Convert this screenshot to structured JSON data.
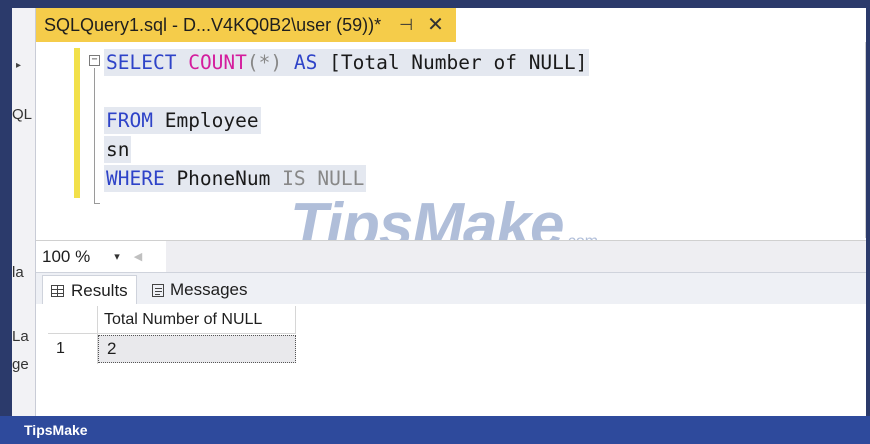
{
  "tab": {
    "title": "SQLQuery1.sql - D...V4KQ0B2\\user (59))*",
    "pin_glyph": "⊣",
    "close_glyph": "✕"
  },
  "editor": {
    "lines": [
      [
        {
          "text": "SELECT",
          "style": "kw"
        },
        {
          "text": " ",
          "style": "txt"
        },
        {
          "text": "COUNT",
          "style": "fn"
        },
        {
          "text": "(*)",
          "style": "gray"
        },
        {
          "text": " ",
          "style": "txt"
        },
        {
          "text": "AS",
          "style": "kw"
        },
        {
          "text": " [Total Number of NULL]",
          "style": "txt"
        }
      ],
      [],
      [
        {
          "text": "FROM",
          "style": "kw"
        },
        {
          "text": " Employee",
          "style": "txt"
        }
      ],
      [
        {
          "text": "sn",
          "style": "txt"
        }
      ],
      [
        {
          "text": "WHERE",
          "style": "kw"
        },
        {
          "text": " PhoneNum ",
          "style": "txt"
        },
        {
          "text": "IS",
          "style": "gray"
        },
        {
          "text": " ",
          "style": "txt"
        },
        {
          "text": "NULL",
          "style": "gray"
        }
      ]
    ]
  },
  "watermark": {
    "brand": "TipsMake",
    "suffix": ".com"
  },
  "zoom": {
    "value": "100 %",
    "caret_glyph": "▾",
    "scroll_left_glyph": "◀"
  },
  "results_tabs": [
    {
      "label": "Results",
      "icon": "grid-icon",
      "active": true
    },
    {
      "label": "Messages",
      "icon": "messages-icon",
      "active": false
    }
  ],
  "grid": {
    "columns": [
      "Total Number of NULL"
    ],
    "rows": [
      {
        "row_number": "1",
        "cells": [
          "2"
        ]
      }
    ]
  },
  "left_panel": {
    "fragments": [
      "QL",
      "la",
      "La",
      "ge"
    ]
  },
  "status": {
    "text": "TipsMake"
  },
  "colors": {
    "tab_active": "#f5cc4a",
    "keyword": "#2e43c8",
    "function": "#d41d9d",
    "status_bar": "#2e4a9c"
  }
}
